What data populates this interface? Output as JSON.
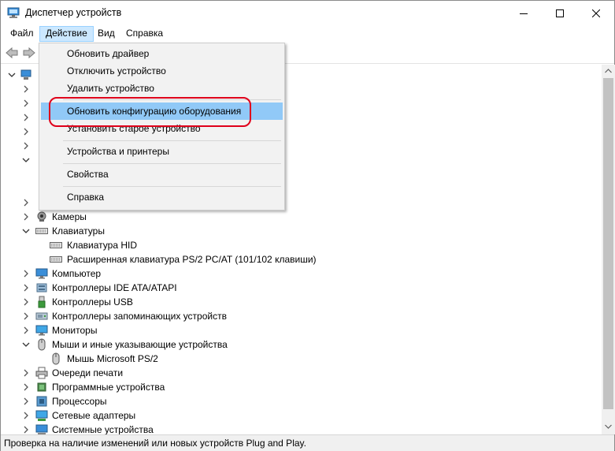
{
  "window": {
    "title": "Диспетчер устройств",
    "controls": {
      "minimize": "minimize",
      "maximize": "maximize",
      "close": "close"
    }
  },
  "menubar": {
    "items": [
      {
        "label": "Файл",
        "active": false
      },
      {
        "label": "Действие",
        "active": true
      },
      {
        "label": "Вид",
        "active": false
      },
      {
        "label": "Справка",
        "active": false
      }
    ]
  },
  "toolbar": {
    "back_icon": "back-arrow-icon",
    "forward_icon": "forward-arrow-icon"
  },
  "action_menu": {
    "items": [
      {
        "label": "Обновить драйвер"
      },
      {
        "label": "Отключить устройство"
      },
      {
        "label": "Удалить устройство"
      },
      {
        "label": "Обновить конфигурацию оборудования",
        "highlighted": true
      },
      {
        "label": "Установить старое устройство"
      },
      {
        "label": "Устройства и принтеры"
      },
      {
        "label": "Свойства"
      },
      {
        "label": "Справка"
      }
    ]
  },
  "tree": {
    "visible_rows": [
      {
        "label": "Камеры",
        "expanded": false,
        "level": 1,
        "icon": "camera-icon"
      },
      {
        "label": "Клавиатуры",
        "expanded": true,
        "level": 1,
        "icon": "keyboard-icon"
      },
      {
        "label": "Клавиатура HID",
        "level": 2,
        "icon": "keyboard-icon"
      },
      {
        "label": "Расширенная клавиатура PS/2 PC/AT (101/102 клавиши)",
        "level": 2,
        "icon": "keyboard-icon"
      },
      {
        "label": "Компьютер",
        "expanded": false,
        "level": 1,
        "icon": "monitor-icon"
      },
      {
        "label": "Контроллеры IDE ATA/ATAPI",
        "expanded": false,
        "level": 1,
        "icon": "controller-icon"
      },
      {
        "label": "Контроллеры USB",
        "expanded": false,
        "level": 1,
        "icon": "usb-icon"
      },
      {
        "label": "Контроллеры запоминающих устройств",
        "expanded": false,
        "level": 1,
        "icon": "storage-icon"
      },
      {
        "label": "Мониторы",
        "expanded": false,
        "level": 1,
        "icon": "monitor-icon"
      },
      {
        "label": "Мыши и иные указывающие устройства",
        "expanded": true,
        "level": 1,
        "icon": "mouse-icon"
      },
      {
        "label": "Мышь Microsoft PS/2",
        "level": 2,
        "icon": "mouse-icon"
      },
      {
        "label": "Очереди печати",
        "expanded": false,
        "level": 1,
        "icon": "printer-icon"
      },
      {
        "label": "Программные устройства",
        "expanded": false,
        "level": 1,
        "icon": "chip-icon"
      },
      {
        "label": "Процессоры",
        "expanded": false,
        "level": 1,
        "icon": "processor-icon"
      },
      {
        "label": "Сетевые адаптеры",
        "expanded": false,
        "level": 1,
        "icon": "network-icon"
      },
      {
        "label": "Системные устройства",
        "expanded": false,
        "level": 1,
        "icon": "system-icon"
      }
    ]
  },
  "statusbar": {
    "text": "Проверка на наличие изменений или новых устройств Plug and Play."
  },
  "colors": {
    "menu_highlight": "#91c9f7",
    "active_menu_bg": "#cce8ff",
    "annotation_ring": "#e0001b"
  }
}
